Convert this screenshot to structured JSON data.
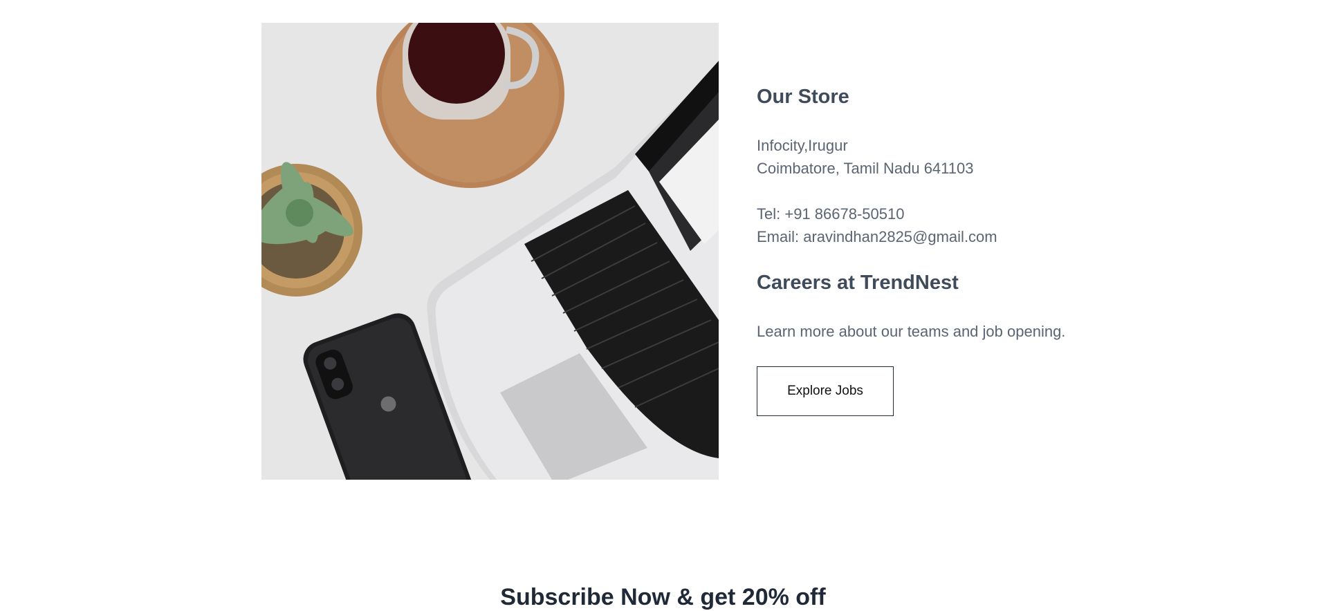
{
  "store": {
    "image_alt": "Desk with laptop, phone, succulent plant and coffee",
    "title": "Our Store",
    "address_line1": "Infocity,Irugur",
    "address_line2": "Coimbatore, Tamil Nadu 641103",
    "tel": "Tel: +91 86678-50510",
    "email": "Email: aravindhan2825@gmail.com"
  },
  "careers": {
    "title": "Careers at TrendNest",
    "text": "Learn more about our teams and job opening.",
    "button_label": "Explore Jobs"
  },
  "subscribe": {
    "title": "Subscribe Now & get 20% off"
  }
}
